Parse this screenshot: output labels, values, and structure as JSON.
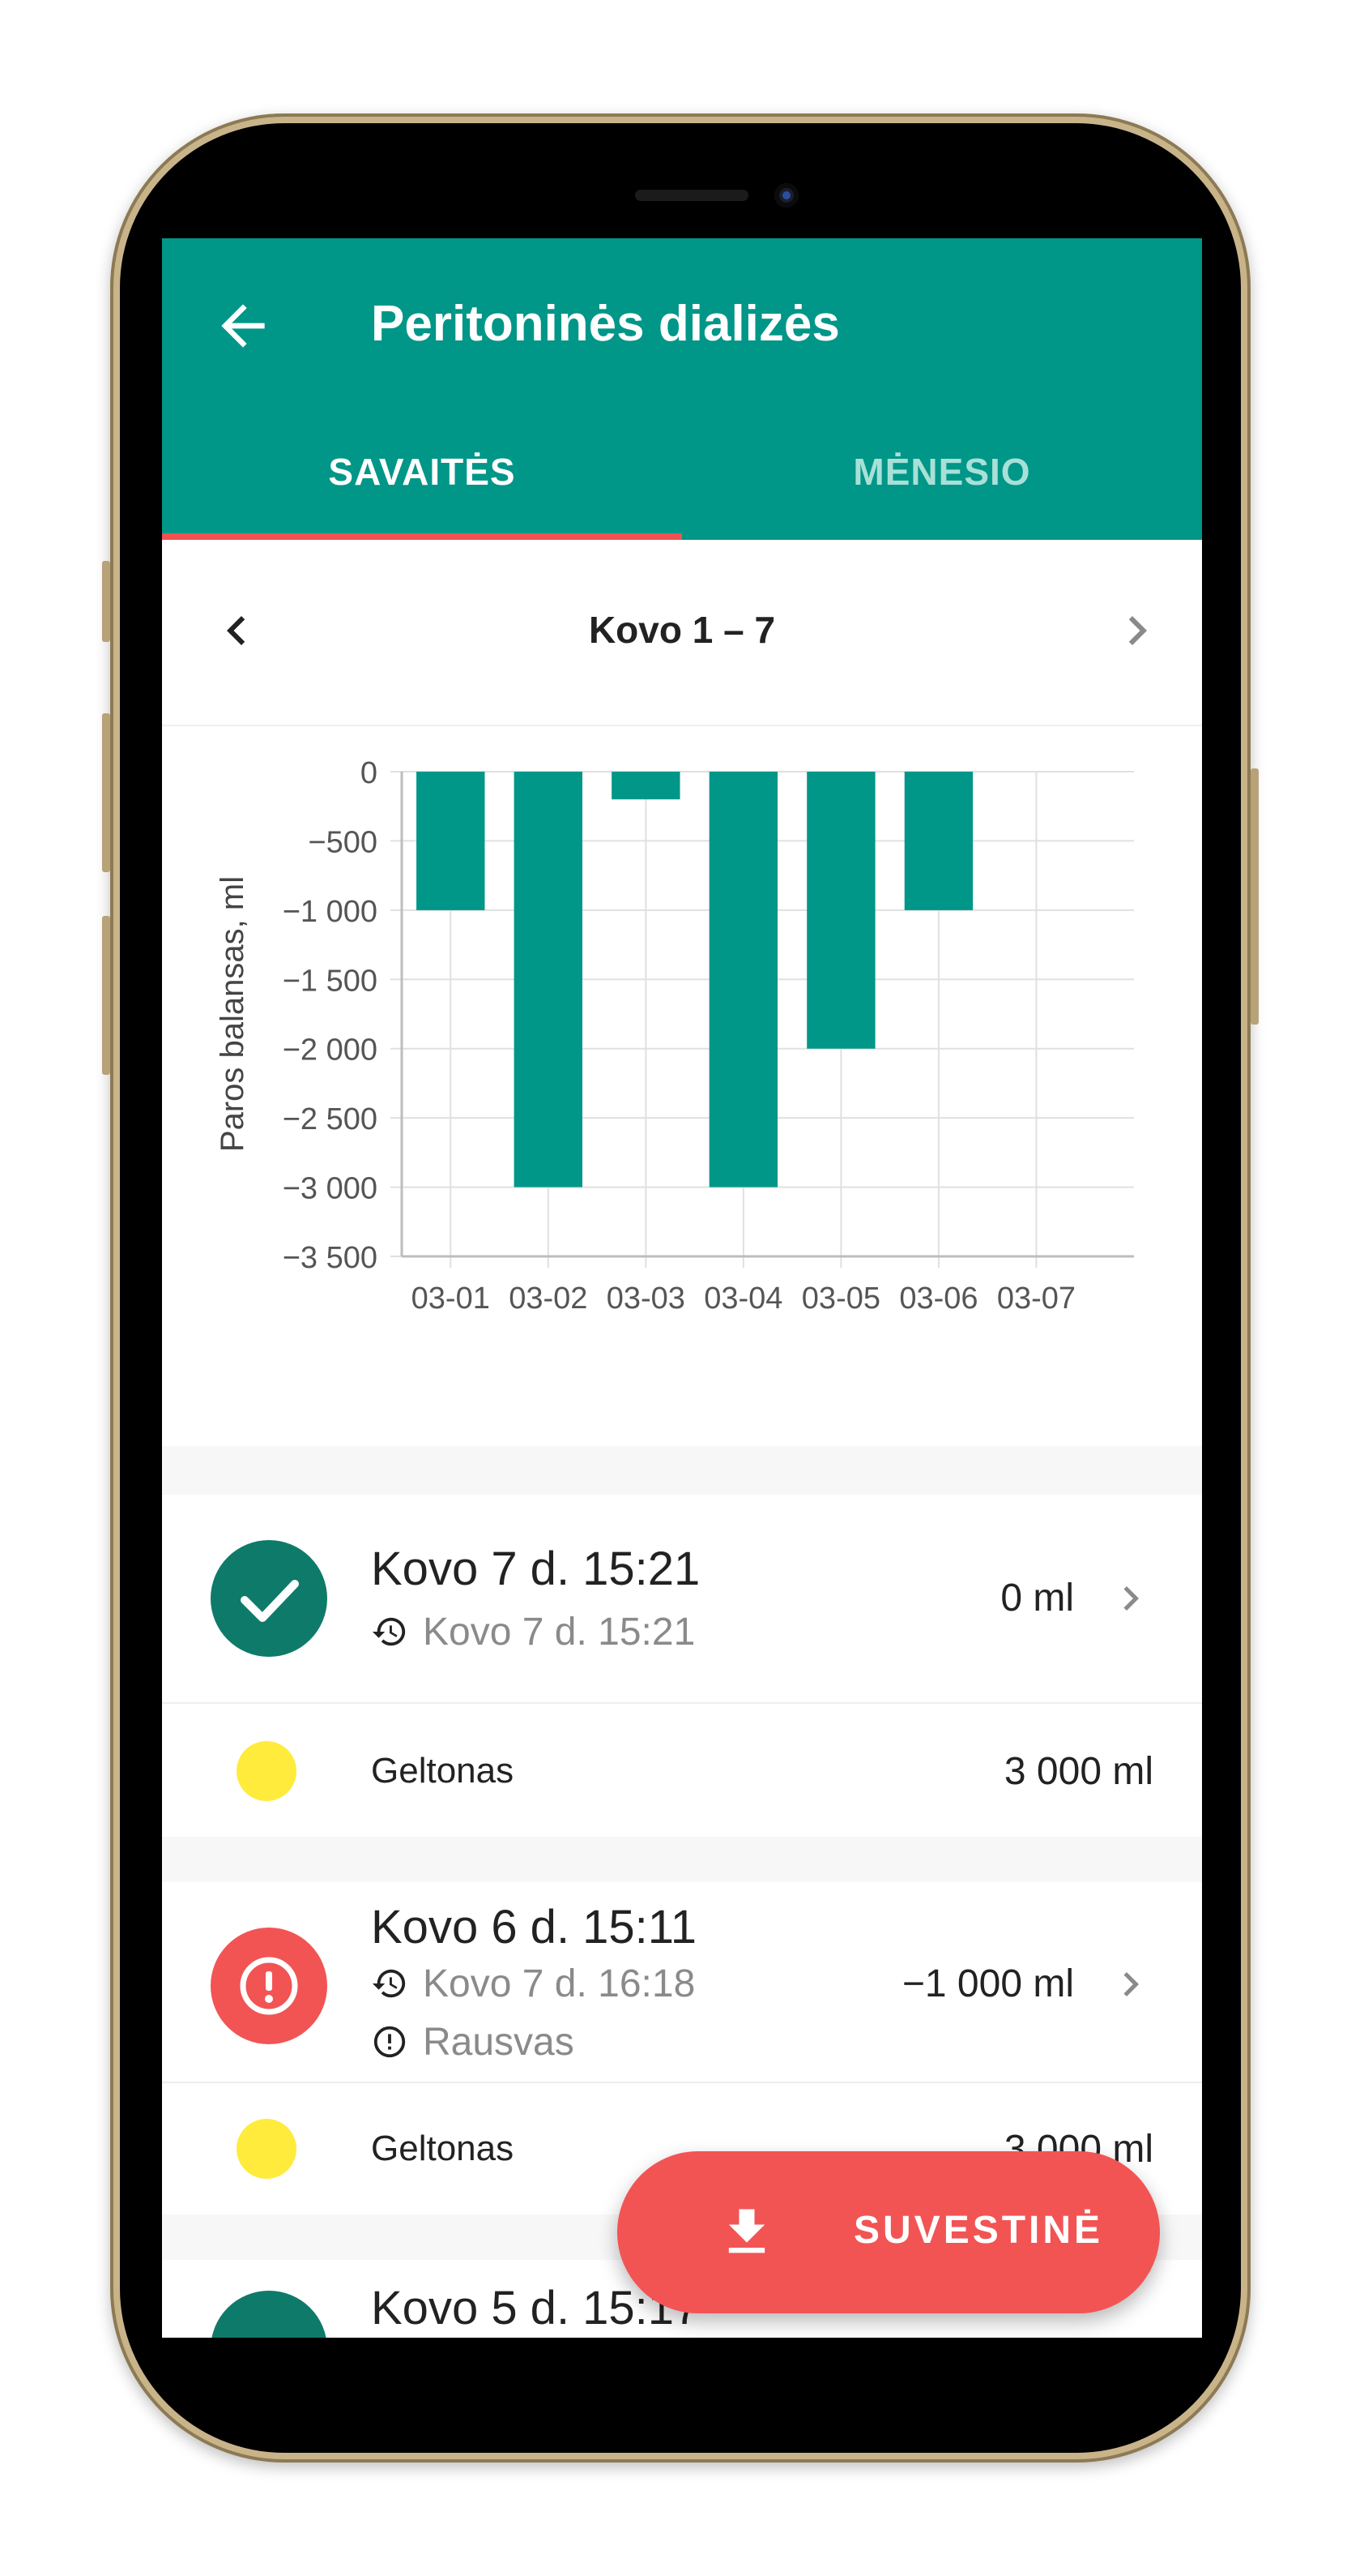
{
  "appbar": {
    "title": "Peritoninės dializės",
    "back_icon": "arrow-left-icon"
  },
  "tabs": [
    {
      "label": "SAVAITĖS",
      "active": true
    },
    {
      "label": "MĖNESIO",
      "active": false
    }
  ],
  "period": {
    "label": "Kovo 1 – 7",
    "prev_icon": "chevron-left-icon",
    "next_icon": "chevron-right-icon"
  },
  "chart_data": {
    "type": "bar",
    "ylabel": "Paros balansas, ml",
    "xlabel": "",
    "categories": [
      "03-01",
      "03-02",
      "03-03",
      "03-04",
      "03-05",
      "03-06",
      "03-07"
    ],
    "values": [
      -1000,
      -3000,
      -200,
      -3000,
      -2000,
      -1000,
      null
    ],
    "ylim": [
      -3500,
      0
    ],
    "yticks": [
      0,
      -500,
      -1000,
      -1500,
      -2000,
      -2500,
      -3000,
      -3500
    ],
    "ytick_labels": [
      "0",
      "−500",
      "−1 000",
      "−1 500",
      "−2 000",
      "−2 500",
      "−3 000",
      "−3 500"
    ],
    "grid": true,
    "color": "#009688"
  },
  "records": [
    {
      "title": "Kovo 7 d. 15:21",
      "sub": "Kovo 7 d. 15:21",
      "sub_icon": "history-icon",
      "value": "0 ml",
      "status": "ok",
      "status_icon": "check-icon",
      "status_color": "#0e7a6a",
      "bag": {
        "name": "Geltonas",
        "value": "3 000 ml",
        "color": "#ffeb3b"
      }
    },
    {
      "title": "Kovo 6 d. 15:11",
      "sub": "Kovo 7 d. 16:18",
      "sub_icon": "history-icon",
      "warning": "Rausvas",
      "warning_icon": "alert-circle-icon",
      "value": "−1 000 ml",
      "status": "warning",
      "status_icon": "alert-circle-icon",
      "status_color": "#f25454",
      "bag": {
        "name": "Geltonas",
        "value": "3 000 ml",
        "color": "#ffeb3b"
      }
    },
    {
      "title": "Kovo 5 d. 15:17",
      "status_color": "#0e7a6a"
    }
  ],
  "fab": {
    "label": "SUVESTINĖ",
    "icon": "download-icon"
  }
}
